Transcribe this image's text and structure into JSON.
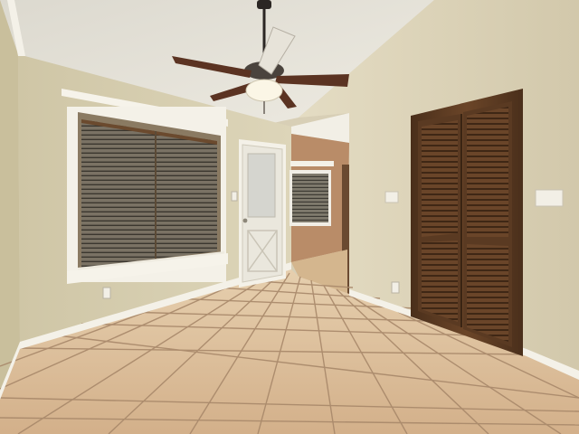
{
  "scene": {
    "description_tags": [
      "ceiling-fan",
      "window-with-blinds",
      "exterior-door",
      "bifold-louvered-closet-door",
      "tile-floor"
    ],
    "colors": {
      "wall_left": "#d9d1b3",
      "wall_right": "#ddd5bb",
      "ceiling": "#e6e3d9",
      "floor_tile": "#d9b892",
      "grout": "#a8886a",
      "trim": "#f4f1e8",
      "closet_wood": "#5a3a22",
      "hall_wall": "#b98c68"
    }
  }
}
